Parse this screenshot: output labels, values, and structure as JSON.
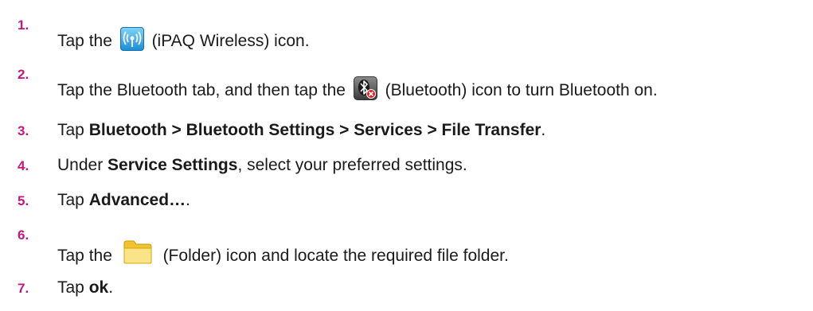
{
  "accent_color": "#c0187e",
  "steps": [
    {
      "number": "1.",
      "text_before": "Tap the ",
      "icon": "wifi-icon",
      "text_after": " (iPAQ Wireless) icon."
    },
    {
      "number": "2.",
      "text_before": "Tap the Bluetooth tab, and then tap the ",
      "icon": "bluetooth-icon",
      "text_after": " (Bluetooth) icon to turn Bluetooth on."
    },
    {
      "number": "3.",
      "text_before": "Tap ",
      "bold": "Bluetooth > Bluetooth Settings > Services > File Transfer",
      "text_after": "."
    },
    {
      "number": "4.",
      "text_before": "Under ",
      "bold": "Service Settings",
      "text_after": ", select your preferred settings."
    },
    {
      "number": "5.",
      "text_before": "Tap ",
      "bold": "Advanced…",
      "text_after": "."
    },
    {
      "number": "6.",
      "text_before": "Tap the ",
      "icon": "folder-icon",
      "text_after": " (Folder) icon and locate the required file folder."
    },
    {
      "number": "7.",
      "text_before": "Tap ",
      "bold": "ok",
      "text_after": "."
    }
  ]
}
